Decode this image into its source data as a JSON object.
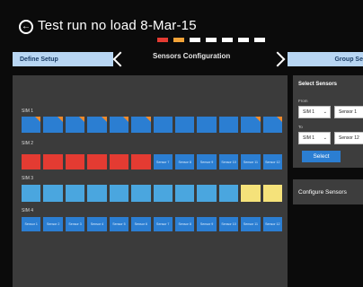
{
  "header": {
    "title": "Test run no load 8-Mar-15",
    "progress_colors": [
      "#e43b32",
      "#f3a338",
      "#ffffff",
      "#ffffff",
      "#ffffff",
      "#ffffff",
      "#ffffff"
    ]
  },
  "steps": {
    "prev": "Define Setup",
    "current": "Sensors Configuration",
    "next": "Group Se"
  },
  "sims": [
    {
      "label": "SIM 1",
      "sensors": [
        {
          "text": "",
          "color": "blue",
          "flag": true
        },
        {
          "text": "",
          "color": "blue",
          "flag": true
        },
        {
          "text": "",
          "color": "blue",
          "flag": true
        },
        {
          "text": "",
          "color": "blue",
          "flag": true
        },
        {
          "text": "",
          "color": "blue",
          "flag": true
        },
        {
          "text": "",
          "color": "blue",
          "flag": true
        },
        {
          "text": "",
          "color": "blue",
          "flag": false
        },
        {
          "text": "",
          "color": "blue",
          "flag": false
        },
        {
          "text": "",
          "color": "blue",
          "flag": false
        },
        {
          "text": "",
          "color": "blue",
          "flag": false
        },
        {
          "text": "",
          "color": "blue",
          "flag": true
        },
        {
          "text": "",
          "color": "blue",
          "flag": true
        }
      ]
    },
    {
      "label": "SIM 2",
      "sensors": [
        {
          "text": "",
          "color": "red"
        },
        {
          "text": "",
          "color": "red"
        },
        {
          "text": "",
          "color": "red"
        },
        {
          "text": "",
          "color": "red"
        },
        {
          "text": "",
          "color": "red"
        },
        {
          "text": "",
          "color": "red"
        },
        {
          "text": "Sensor 7",
          "color": "blue"
        },
        {
          "text": "Sensor 8",
          "color": "blue"
        },
        {
          "text": "Sensor 9",
          "color": "blue"
        },
        {
          "text": "Sensor 10",
          "color": "blue"
        },
        {
          "text": "Sensor 11",
          "color": "blue"
        },
        {
          "text": "Sensor 12",
          "color": "blue"
        }
      ]
    },
    {
      "label": "SIM 3",
      "sensors": [
        {
          "text": "",
          "color": "cyan"
        },
        {
          "text": "",
          "color": "cyan"
        },
        {
          "text": "",
          "color": "cyan"
        },
        {
          "text": "",
          "color": "cyan"
        },
        {
          "text": "",
          "color": "cyan"
        },
        {
          "text": "",
          "color": "cyan"
        },
        {
          "text": "",
          "color": "cyan"
        },
        {
          "text": "",
          "color": "cyan"
        },
        {
          "text": "",
          "color": "cyan"
        },
        {
          "text": "",
          "color": "cyan"
        },
        {
          "text": "",
          "color": "yellow"
        },
        {
          "text": "",
          "color": "yellow"
        }
      ]
    },
    {
      "label": "SIM 4",
      "sensors": [
        {
          "text": "Sensor 1",
          "color": "blue"
        },
        {
          "text": "Sensor 2",
          "color": "blue"
        },
        {
          "text": "Sensor 3",
          "color": "blue"
        },
        {
          "text": "Sensor 4",
          "color": "blue"
        },
        {
          "text": "Sensor 5",
          "color": "blue"
        },
        {
          "text": "Sensor 6",
          "color": "blue"
        },
        {
          "text": "Sensor 7",
          "color": "blue"
        },
        {
          "text": "Sensor 8",
          "color": "blue"
        },
        {
          "text": "Sensor 9",
          "color": "blue"
        },
        {
          "text": "Sensor 10",
          "color": "blue"
        },
        {
          "text": "Sensor 11",
          "color": "blue"
        },
        {
          "text": "Sensor 12",
          "color": "blue"
        }
      ]
    }
  ],
  "select_panel": {
    "heading": "Select Sensors",
    "from_label": "From",
    "from_sim": "SIM 1",
    "from_sensor": "Sensor 1",
    "to_label": "To",
    "to_sim": "SIM 1",
    "to_sensor": "Sensor 12",
    "select_button": "Select"
  },
  "configure_panel": {
    "label": "Configure Sensors"
  },
  "colors": {
    "blue": "#2b7ed2",
    "red": "#e43b32",
    "cyan": "#4aa6df",
    "yellow": "#f5e27a",
    "flag": "#f08a2c"
  }
}
